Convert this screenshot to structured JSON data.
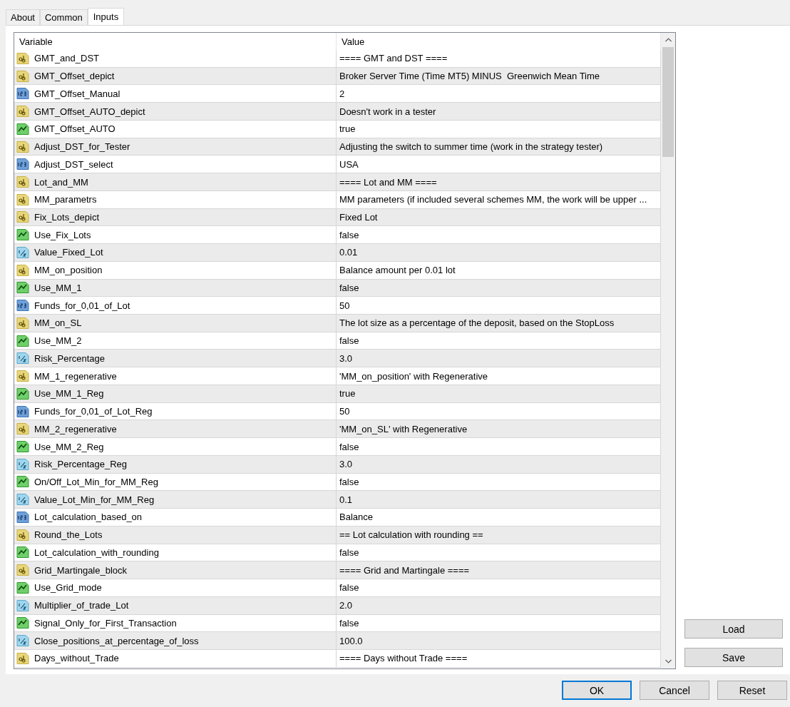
{
  "tabs": [
    {
      "label": "About",
      "selected": false
    },
    {
      "label": "Common",
      "selected": false
    },
    {
      "label": "Inputs",
      "selected": true
    }
  ],
  "table": {
    "columns": [
      "Variable",
      "Value"
    ],
    "rows": [
      {
        "kind": "string",
        "variable": "GMT_and_DST",
        "value": "==== GMT and DST ===="
      },
      {
        "kind": "string",
        "variable": "GMT_Offset_depict",
        "value": "Broker Server Time (Time MT5) MINUS  Greenwich Mean Time"
      },
      {
        "kind": "integer",
        "variable": "GMT_Offset_Manual",
        "value": "2"
      },
      {
        "kind": "string",
        "variable": "GMT_Offset_AUTO_depict",
        "value": "Doesn't work in a tester"
      },
      {
        "kind": "bool",
        "variable": "GMT_Offset_AUTO",
        "value": "true"
      },
      {
        "kind": "string",
        "variable": "Adjust_DST_for_Tester",
        "value": "Adjusting the switch to summer time (work in the strategy tester)"
      },
      {
        "kind": "integer",
        "variable": "Adjust_DST_select",
        "value": "USA"
      },
      {
        "kind": "string",
        "variable": "Lot_and_MM",
        "value": "==== Lot and MM ===="
      },
      {
        "kind": "string",
        "variable": "MM_parametrs",
        "value": "MM parameters (if included several schemes MM, the work will be upper ..."
      },
      {
        "kind": "string",
        "variable": "Fix_Lots_depict",
        "value": "Fixed Lot"
      },
      {
        "kind": "bool",
        "variable": "Use_Fix_Lots",
        "value": "false"
      },
      {
        "kind": "double",
        "variable": "Value_Fixed_Lot",
        "value": "0.01"
      },
      {
        "kind": "string",
        "variable": "MM_on_position",
        "value": "Balance amount per 0.01 lot"
      },
      {
        "kind": "bool",
        "variable": "Use_MM_1",
        "value": "false"
      },
      {
        "kind": "integer",
        "variable": "Funds_for_0,01_of_Lot",
        "value": "50"
      },
      {
        "kind": "string",
        "variable": "MM_on_SL",
        "value": "The lot size as a percentage of the deposit, based on the StopLoss"
      },
      {
        "kind": "bool",
        "variable": "Use_MM_2",
        "value": "false"
      },
      {
        "kind": "double",
        "variable": "Risk_Percentage",
        "value": "3.0"
      },
      {
        "kind": "string",
        "variable": "MM_1_regenerative",
        "value": "'MM_on_position' with Regenerative"
      },
      {
        "kind": "bool",
        "variable": "Use_MM_1_Reg",
        "value": "true"
      },
      {
        "kind": "integer",
        "variable": "Funds_for_0,01_of_Lot_Reg",
        "value": "50"
      },
      {
        "kind": "string",
        "variable": "MM_2_regenerative",
        "value": "'MM_on_SL' with Regenerative"
      },
      {
        "kind": "bool",
        "variable": "Use_MM_2_Reg",
        "value": "false"
      },
      {
        "kind": "double",
        "variable": "Risk_Percentage_Reg",
        "value": "3.0"
      },
      {
        "kind": "bool",
        "variable": "On/Off_Lot_Min_for_MM_Reg",
        "value": "false"
      },
      {
        "kind": "double",
        "variable": "Value_Lot_Min_for_MM_Reg",
        "value": "0.1"
      },
      {
        "kind": "integer",
        "variable": "Lot_calculation_based_on",
        "value": "Balance"
      },
      {
        "kind": "string",
        "variable": "Round_the_Lots",
        "value": "== Lot calculation with rounding =="
      },
      {
        "kind": "bool",
        "variable": "Lot_calculation_with_rounding",
        "value": "false"
      },
      {
        "kind": "string",
        "variable": "Grid_Martingale_block",
        "value": "==== Grid and Martingale ===="
      },
      {
        "kind": "bool",
        "variable": "Use_Grid_mode",
        "value": "false"
      },
      {
        "kind": "double",
        "variable": "Multiplier_of_trade_Lot",
        "value": "2.0"
      },
      {
        "kind": "bool",
        "variable": "Signal_Only_for_First_Transaction",
        "value": "false"
      },
      {
        "kind": "double",
        "variable": "Close_positions_at_percentage_of_loss",
        "value": "100.0"
      },
      {
        "kind": "string",
        "variable": "Days_without_Trade",
        "value": "==== Days without Trade ===="
      }
    ]
  },
  "side_buttons": [
    "Load",
    "Save"
  ],
  "dialog_buttons": [
    {
      "label": "OK",
      "default": true
    },
    {
      "label": "Cancel",
      "default": false
    },
    {
      "label": "Reset",
      "default": false
    }
  ]
}
